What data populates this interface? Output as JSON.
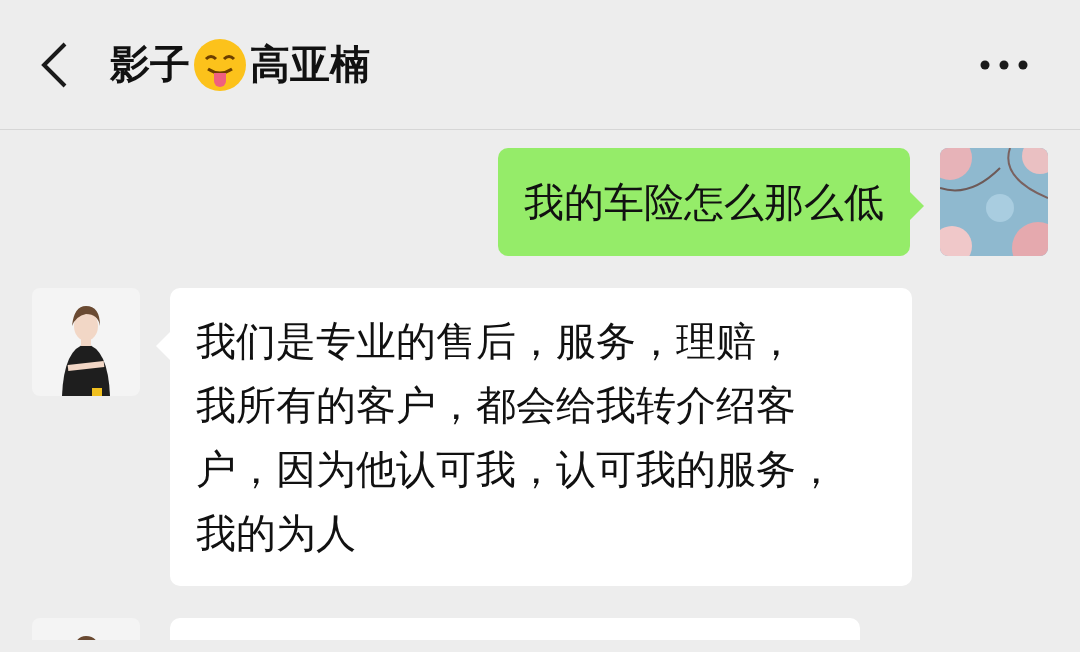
{
  "header": {
    "title_start": "影子",
    "title_end": "高亚楠"
  },
  "messages": [
    {
      "kind": "outgoing",
      "lines": [
        "我的车险怎么那么低"
      ]
    },
    {
      "kind": "incoming",
      "lines": [
        "我们是专业的售后，服务，理赔，",
        "我所有的客户，都会给我转介绍客",
        "户，因为他认可我，认可我的服务，",
        "我的为人"
      ]
    },
    {
      "kind": "incoming"
    }
  ]
}
